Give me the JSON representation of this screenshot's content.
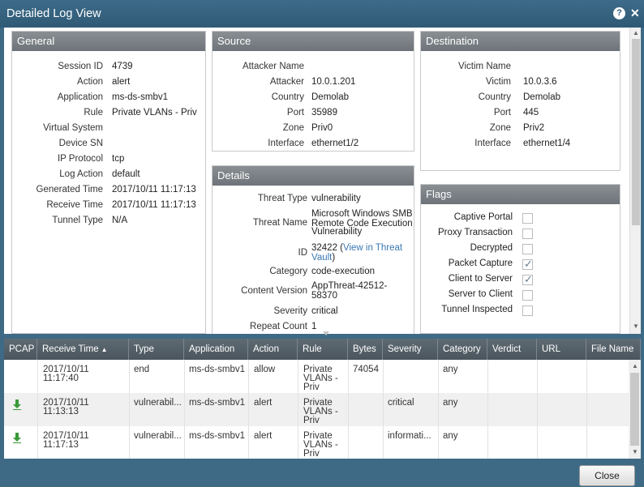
{
  "window": {
    "title": "Detailed Log View"
  },
  "general": {
    "header": "General",
    "rows": [
      {
        "label": "Session ID",
        "value": "4739"
      },
      {
        "label": "Action",
        "value": "alert"
      },
      {
        "label": "Application",
        "value": "ms-ds-smbv1"
      },
      {
        "label": "Rule",
        "value": "Private VLANs - Priv"
      },
      {
        "label": "Virtual System",
        "value": ""
      },
      {
        "label": "Device SN",
        "value": ""
      },
      {
        "label": "IP Protocol",
        "value": "tcp"
      },
      {
        "label": "Log Action",
        "value": "default"
      },
      {
        "label": "Generated Time",
        "value": "2017/10/11 11:17:13"
      },
      {
        "label": "Receive Time",
        "value": "2017/10/11 11:17:13"
      },
      {
        "label": "Tunnel Type",
        "value": "N/A"
      }
    ]
  },
  "source": {
    "header": "Source",
    "rows": [
      {
        "label": "Attacker Name",
        "value": ""
      },
      {
        "label": "Attacker",
        "value": "10.0.1.201"
      },
      {
        "label": "Country",
        "value": "Demolab"
      },
      {
        "label": "Port",
        "value": "35989"
      },
      {
        "label": "Zone",
        "value": "Priv0"
      },
      {
        "label": "Interface",
        "value": "ethernet1/2"
      }
    ]
  },
  "destination": {
    "header": "Destination",
    "rows": [
      {
        "label": "Victim Name",
        "value": ""
      },
      {
        "label": "Victim",
        "value": "10.0.3.6"
      },
      {
        "label": "Country",
        "value": "Demolab"
      },
      {
        "label": "Port",
        "value": "445"
      },
      {
        "label": "Zone",
        "value": "Priv2"
      },
      {
        "label": "Interface",
        "value": "ethernet1/4"
      }
    ]
  },
  "details": {
    "header": "Details",
    "threat_type": {
      "label": "Threat Type",
      "value": "vulnerability"
    },
    "threat_name": {
      "label": "Threat Name",
      "lines": [
        "Microsoft Windows SMB",
        "Remote Code Execution",
        "Vulnerability"
      ]
    },
    "id": {
      "label": "ID",
      "value": "32422 (",
      "link_line1": "View in Threat",
      "link_line2": "Vault",
      "close": ")"
    },
    "category": {
      "label": "Category",
      "value": "code-execution"
    },
    "content_version": {
      "label": "Content Version",
      "lines": [
        "AppThreat-42512-",
        "58370"
      ]
    },
    "severity": {
      "label": "Severity",
      "value": "critical"
    },
    "repeat_count": {
      "label": "Repeat Count",
      "value": "1"
    }
  },
  "flags": {
    "header": "Flags",
    "items": [
      {
        "label": "Captive Portal",
        "checked": false
      },
      {
        "label": "Proxy Transaction",
        "checked": false
      },
      {
        "label": "Decrypted",
        "checked": false
      },
      {
        "label": "Packet Capture",
        "checked": true
      },
      {
        "label": "Client to Server",
        "checked": true
      },
      {
        "label": "Server to Client",
        "checked": false
      },
      {
        "label": "Tunnel Inspected",
        "checked": false
      }
    ]
  },
  "table": {
    "columns": [
      "PCAP",
      "Receive Time",
      "Type",
      "Application",
      "Action",
      "Rule",
      "Bytes",
      "Severity",
      "Category",
      "Verdict",
      "URL",
      "File Name"
    ],
    "sort_indicator": "▲",
    "rows": [
      {
        "pcap": false,
        "time1": "2017/10/11",
        "time2": "11:17:40",
        "type": "end",
        "application": "ms-ds-smbv1",
        "action": "allow",
        "rule1": "Private",
        "rule2": "VLANs -",
        "rule3": "Priv",
        "bytes": "74054",
        "severity": "",
        "category": "any"
      },
      {
        "pcap": true,
        "time1": "2017/10/11",
        "time2": "11:13:13",
        "type": "vulnerabil...",
        "application": "ms-ds-smbv1",
        "action": "alert",
        "rule1": "Private",
        "rule2": "VLANs -",
        "rule3": "Priv",
        "bytes": "",
        "severity": "critical",
        "category": "any"
      },
      {
        "pcap": true,
        "time1": "2017/10/11",
        "time2": "11:17:13",
        "type": "vulnerabil...",
        "application": "ms-ds-smbv1",
        "action": "alert",
        "rule1": "Private",
        "rule2": "VLANs -",
        "rule3": "Priv",
        "bytes": "",
        "severity": "informati...",
        "category": "any"
      }
    ]
  },
  "footer": {
    "close_label": "Close"
  },
  "colors": {
    "titlebar": "#2f5a76",
    "panel_header": "#6d7378",
    "table_header": "#4a555d",
    "link": "#3a78b3",
    "pcap_icon": "#3a9a3a"
  },
  "icons": {
    "help": "help-icon",
    "close": "close-x-icon",
    "pcap": "pcap-download-icon"
  }
}
